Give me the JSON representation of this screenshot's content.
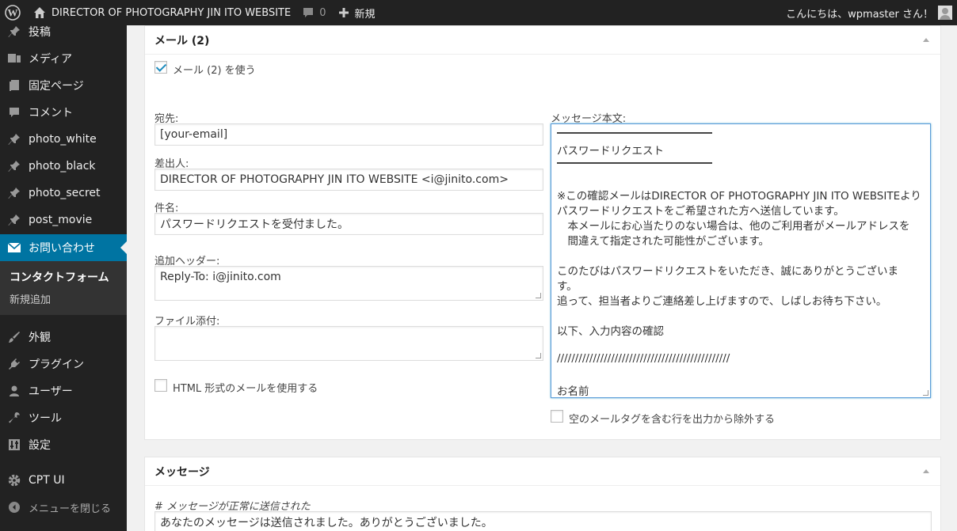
{
  "adminbar": {
    "site_name": "DIRECTOR OF PHOTOGRAPHY JIN ITO WEBSITE",
    "comments_count": "0",
    "new_label": "新規",
    "greeting": "こんにちは、wpmaster さん！"
  },
  "menu": {
    "items": [
      {
        "label": "投稿",
        "icon": "pin-icon"
      },
      {
        "label": "メディア",
        "icon": "media-icon"
      },
      {
        "label": "固定ページ",
        "icon": "page-icon"
      },
      {
        "label": "コメント",
        "icon": "comment-icon"
      },
      {
        "label": "photo_white",
        "icon": "pin-icon"
      },
      {
        "label": "photo_black",
        "icon": "pin-icon"
      },
      {
        "label": "photo_secret",
        "icon": "pin-icon"
      },
      {
        "label": "post_movie",
        "icon": "pin-icon"
      },
      {
        "label": "お問い合わせ",
        "icon": "mail-icon"
      },
      {
        "label": "外観",
        "icon": "appearance-icon"
      },
      {
        "label": "プラグイン",
        "icon": "plugin-icon"
      },
      {
        "label": "ユーザー",
        "icon": "user-icon"
      },
      {
        "label": "ツール",
        "icon": "wrench-icon"
      },
      {
        "label": "設定",
        "icon": "settings-icon"
      },
      {
        "label": "CPT UI",
        "icon": "gear-icon"
      }
    ],
    "submenu": {
      "current": "コンタクトフォーム",
      "add_new": "新規追加"
    },
    "collapse_label": "メニューを閉じる"
  },
  "mail2": {
    "title": "メール (2)",
    "use_label": "メール (2) を使う",
    "to_label": "宛先:",
    "to_value": "[your-email]",
    "from_label": "差出人:",
    "from_value": "DIRECTOR OF  PHOTOGRAPHY JIN ITO WEBSITE <i@jinito.com>",
    "subject_label": "件名:",
    "subject_value": "パスワードリクエストを受付ました。",
    "headers_label": "追加ヘッダー:",
    "headers_value": "Reply-To: i@jinito.com",
    "attach_label": "ファイル添付:",
    "html_label": "HTML 形式のメールを使用する",
    "body_label": "メッセージ本文:",
    "body_lines": [
      "パスワードリクエスト",
      "※この確認メールはDIRECTOR OF  PHOTOGRAPHY JIN ITO WEBSITEより",
      "パスワードリクエストをご希望された方へ送信しています。",
      "　本メールにお心当たりのない場合は、他のご利用者がメールアドレスを",
      "　間違えて指定された可能性がございます。",
      "このたびはパスワードリクエストをいただき、誠にありがとうございま",
      "す。",
      "追って、担当者よりご連絡差し上げますので、しばしお待ち下さい。",
      "以下、入力内容の確認",
      "////////////////////////////////////////////////",
      "お名前"
    ],
    "exclude_label": "空のメールタグを含む行を出力から除外する"
  },
  "messages": {
    "title": "メッセージ",
    "sent_ok_label": "# メッセージが正常に送信された",
    "sent_ok_value": "あなたのメッセージは送信されました。ありがとうございました。"
  }
}
